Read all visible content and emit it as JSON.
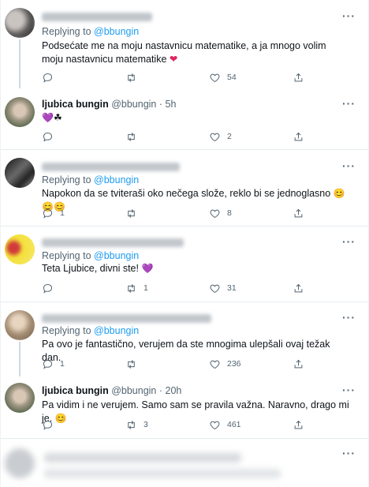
{
  "tweets": [
    {
      "replying_prefix": "Replying to",
      "mention": "@bbungin",
      "text": "Podsećate me na moju nastavnicu matematike, a ja mnogo volim moju nastavnicu matematike",
      "emoji": "❤",
      "stats": {
        "reply": "",
        "retweet": "",
        "like": "54"
      }
    },
    {
      "name": "ljubica bungin",
      "handle": "@bbungin",
      "dot": "·",
      "time": "5h",
      "text": "💜☘",
      "stats": {
        "reply": "",
        "retweet": "",
        "like": "2"
      }
    },
    {
      "replying_prefix": "Replying to",
      "mention": "@bbungin",
      "text": "Napokon da se tviteraši oko nečega slože, reklo bi se jednoglasno",
      "emoji": "😊😊😊",
      "stats": {
        "reply": "1",
        "retweet": "",
        "like": "8"
      }
    },
    {
      "replying_prefix": "Replying to",
      "mention": "@bbungin",
      "text": "Teta Ljubice, divni ste!",
      "emoji": "💜",
      "stats": {
        "reply": "",
        "retweet": "1",
        "like": "31"
      }
    },
    {
      "replying_prefix": "Replying to",
      "mention": "@bbungin",
      "text": "Pa ovo je fantastično, verujem da ste mnogima ulepšali ovaj težak dan.",
      "stats": {
        "reply": "1",
        "retweet": "",
        "like": "236"
      }
    },
    {
      "name": "ljubica bungin",
      "handle": "@bbungin",
      "dot": "·",
      "time": "20h",
      "text": "Pa vidim i ne verujem. Samo sam se pravila važna. Naravno, drago mi je.",
      "emoji": "😊",
      "stats": {
        "reply": "",
        "retweet": "3",
        "like": "461"
      }
    }
  ],
  "more_glyph": "···",
  "colors": {
    "link": "#1d9bf0",
    "secondary": "#536471",
    "heart": "#e0245e"
  }
}
